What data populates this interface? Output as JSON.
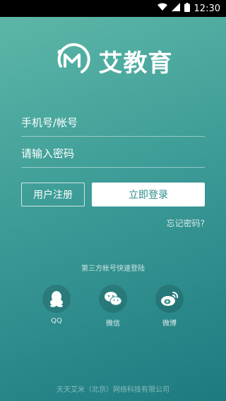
{
  "status": {
    "time": "12:30"
  },
  "brand": {
    "name": "艾教育"
  },
  "form": {
    "account_placeholder": "手机号/帐号",
    "password_placeholder": "请输入密码"
  },
  "buttons": {
    "register": "用户注册",
    "login": "立即登录",
    "forgot": "忘记密码?"
  },
  "third_party": {
    "title": "第三方帐号快速登陆",
    "items": [
      {
        "label": "QQ",
        "icon": "qq-icon"
      },
      {
        "label": "微信",
        "icon": "wechat-icon"
      },
      {
        "label": "微博",
        "icon": "weibo-icon"
      }
    ]
  },
  "footer": "天天艾米（北京）网络科技有限公司",
  "colors": {
    "bg_top": "#5fb9a8",
    "bg_bottom": "#1d7a80",
    "login_text": "#2d8b89"
  }
}
